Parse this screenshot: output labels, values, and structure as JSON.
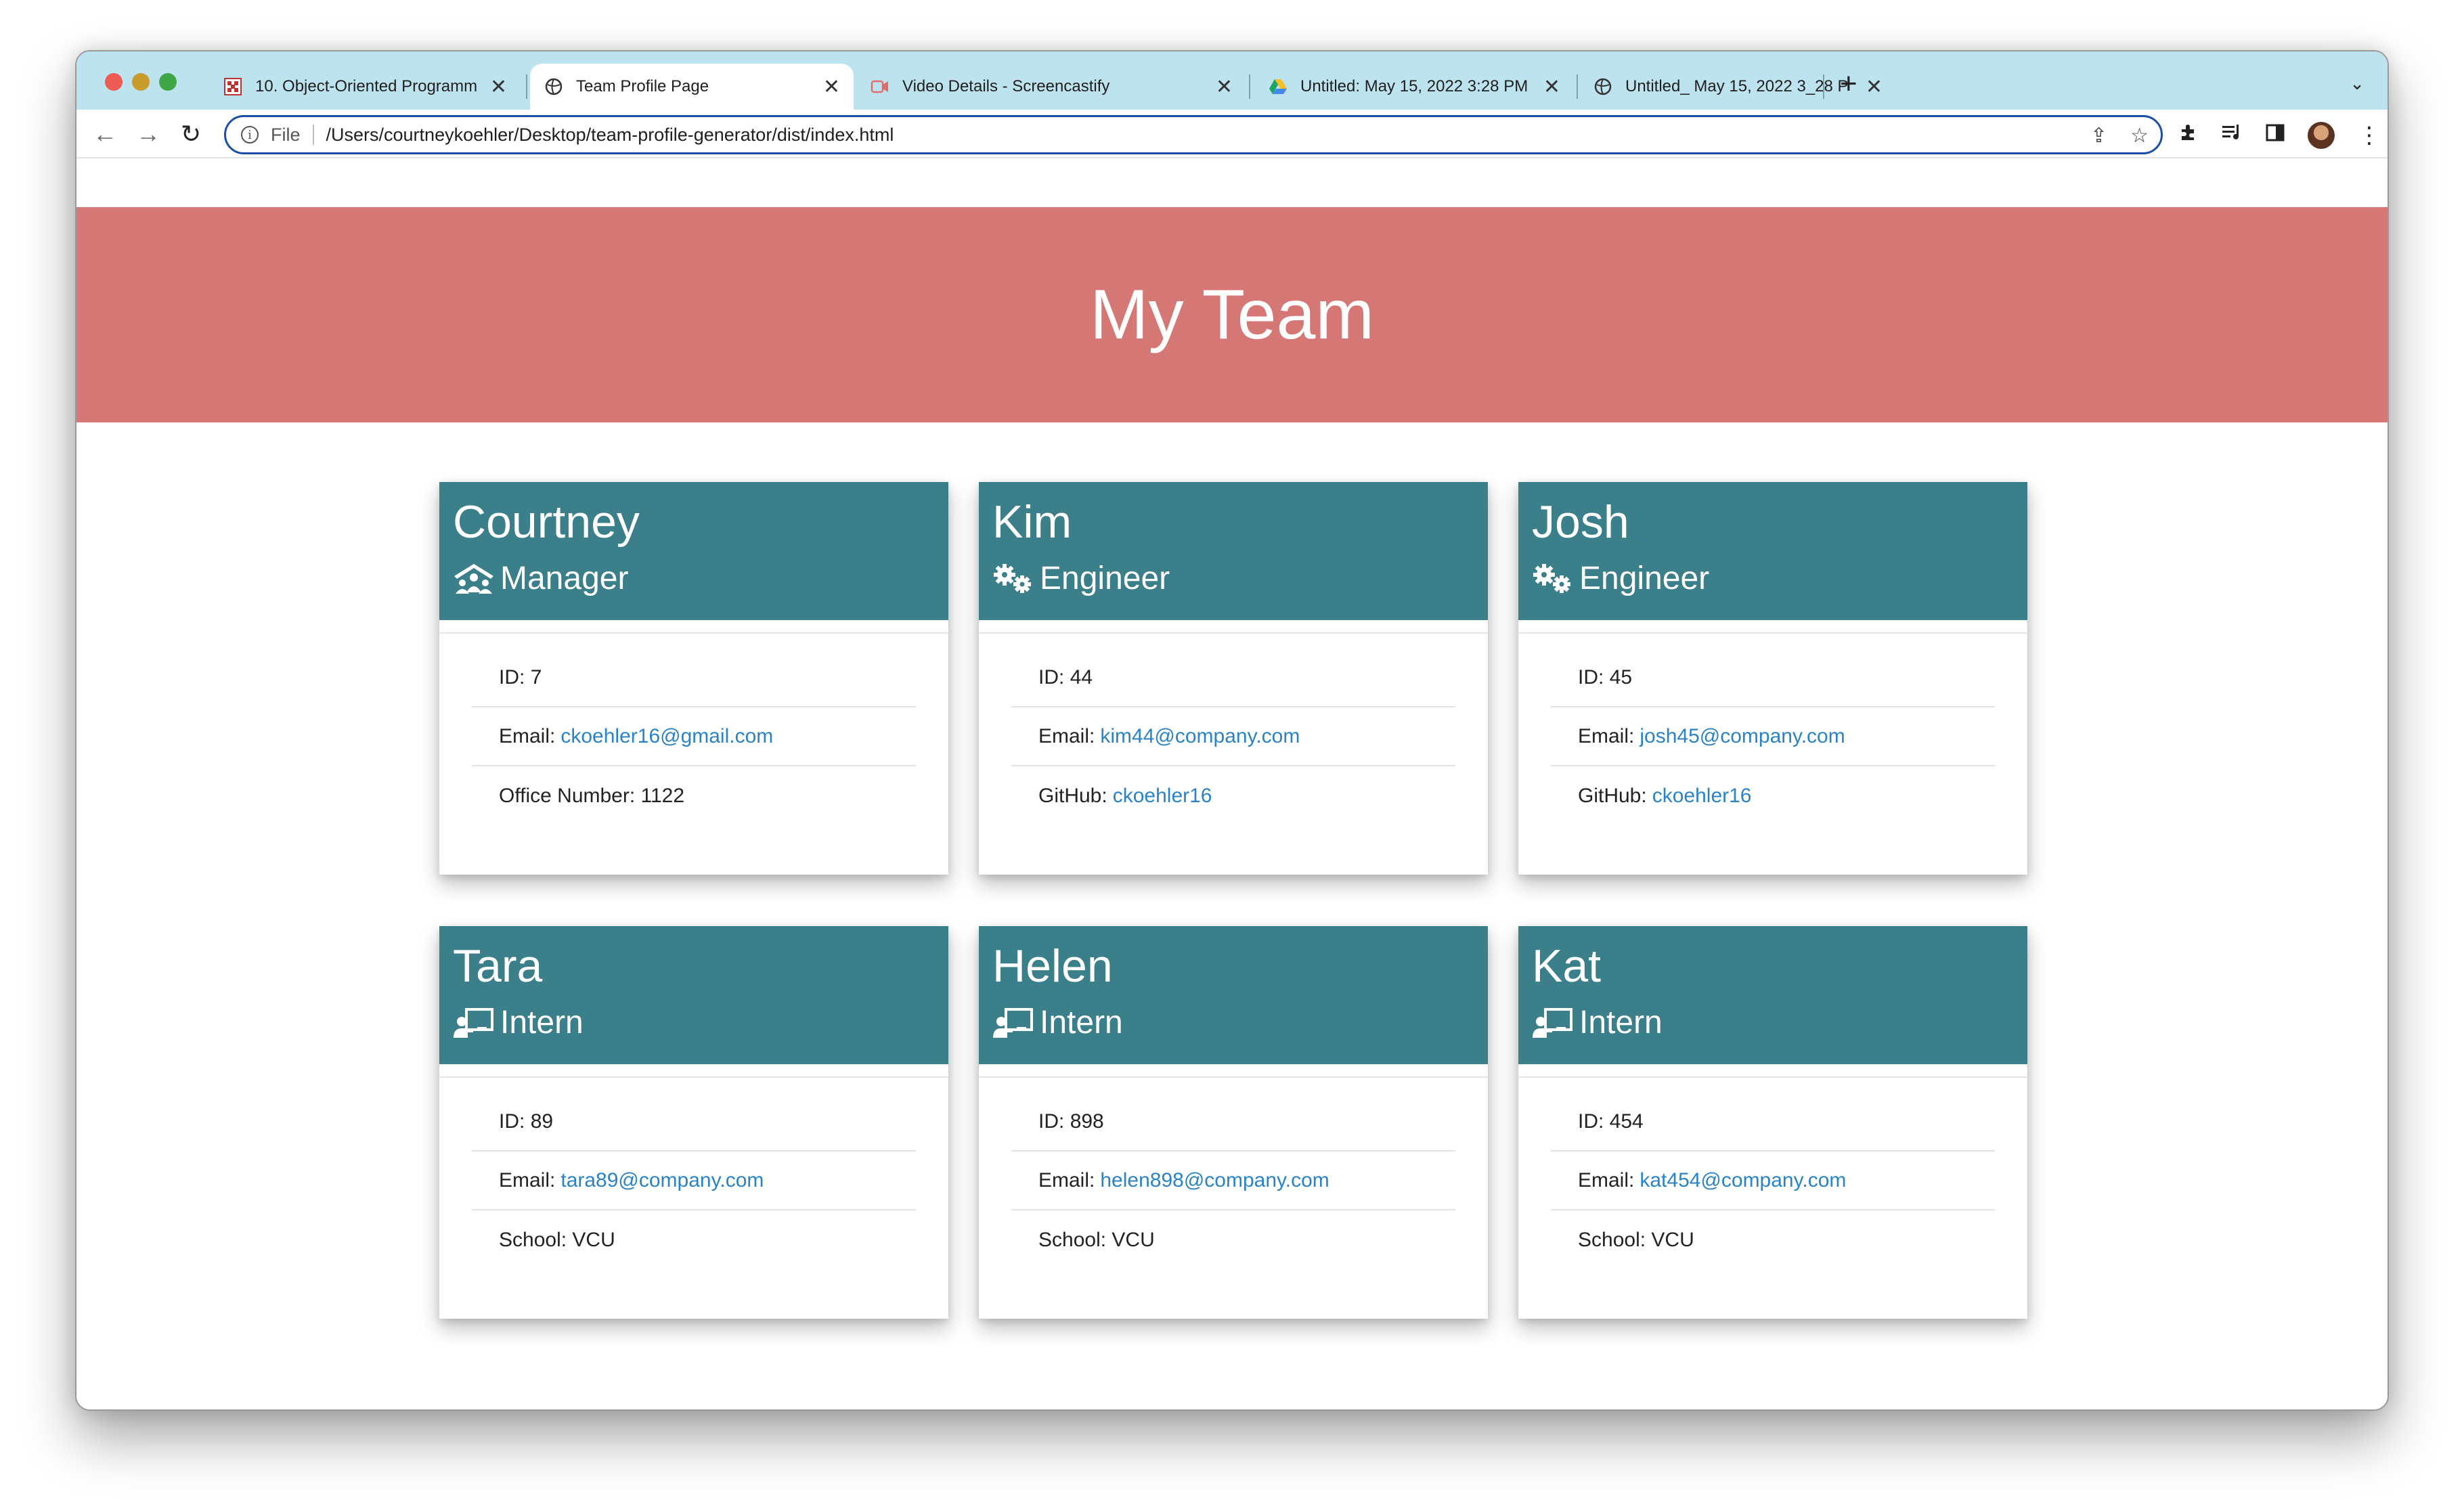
{
  "browser": {
    "tabs": [
      {
        "title": "10. Object-Oriented Programm",
        "favicon": "checkered-icon",
        "active": false
      },
      {
        "title": "Team Profile Page",
        "favicon": "globe-icon",
        "active": true
      },
      {
        "title": "Video Details - Screencastify",
        "favicon": "screencastify-icon",
        "active": false
      },
      {
        "title": "Untitled: May 15, 2022 3:28 PM",
        "favicon": "google-drive-icon",
        "active": false
      },
      {
        "title": "Untitled_ May 15, 2022 3_28 P",
        "favicon": "globe-icon",
        "active": false
      }
    ],
    "new_tab_label": "+",
    "address": {
      "scheme_label": "File",
      "url": "/Users/courtneykoehler/Desktop/team-profile-generator/dist/index.html"
    }
  },
  "page": {
    "title": "My Team",
    "accent_header": "#d57775",
    "card_header": "#3b7f8a",
    "link_color": "#2a83c6"
  },
  "team": [
    {
      "name": "Courtney",
      "role": "Manager",
      "role_icon": "manager-icon",
      "id_label": "ID:",
      "id": "7",
      "email_label": "Email:",
      "email": "ckoehler16@gmail.com",
      "extra_label": "Office Number:",
      "extra": "1122",
      "extra_is_link": false
    },
    {
      "name": "Kim",
      "role": "Engineer",
      "role_icon": "gears-icon",
      "id_label": "ID:",
      "id": "44",
      "email_label": "Email:",
      "email": "kim44@company.com",
      "extra_label": "GitHub:",
      "extra": "ckoehler16",
      "extra_is_link": true
    },
    {
      "name": "Josh",
      "role": "Engineer",
      "role_icon": "gears-icon",
      "id_label": "ID:",
      "id": "45",
      "email_label": "Email:",
      "email": "josh45@company.com",
      "extra_label": "GitHub:",
      "extra": "ckoehler16",
      "extra_is_link": true
    },
    {
      "name": "Tara",
      "role": "Intern",
      "role_icon": "intern-icon",
      "id_label": "ID:",
      "id": "89",
      "email_label": "Email:",
      "email": "tara89@company.com",
      "extra_label": "School:",
      "extra": "VCU",
      "extra_is_link": false
    },
    {
      "name": "Helen",
      "role": "Intern",
      "role_icon": "intern-icon",
      "id_label": "ID:",
      "id": "898",
      "email_label": "Email:",
      "email": "helen898@company.com",
      "extra_label": "School:",
      "extra": "VCU",
      "extra_is_link": false
    },
    {
      "name": "Kat",
      "role": "Intern",
      "role_icon": "intern-icon",
      "id_label": "ID:",
      "id": "454",
      "email_label": "Email:",
      "email": "kat454@company.com",
      "extra_label": "School:",
      "extra": "VCU",
      "extra_is_link": false
    }
  ]
}
